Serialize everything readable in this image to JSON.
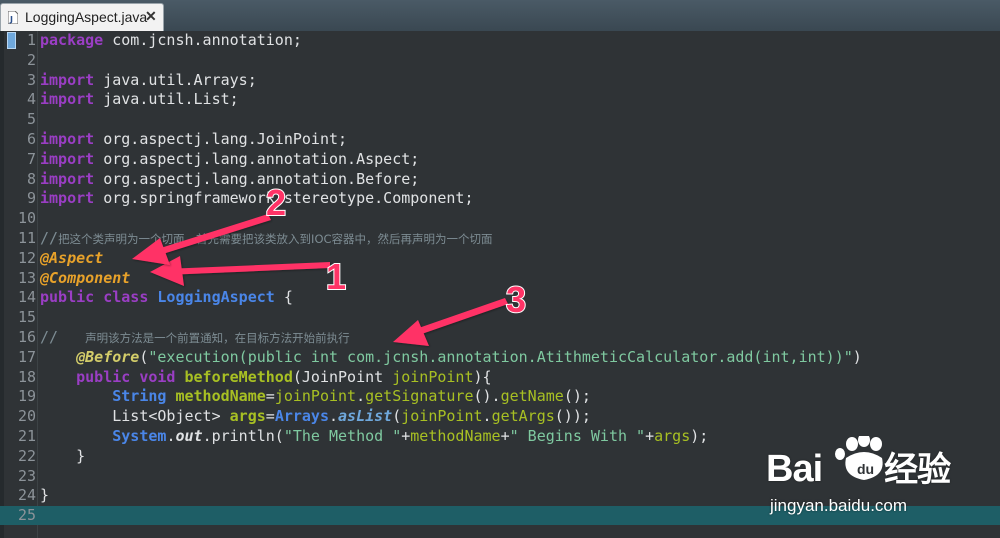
{
  "tab": {
    "title": "LoggingAspect.java",
    "close_glyph": "✕",
    "icon": "java-file-icon"
  },
  "editor": {
    "current_line": 25,
    "lines": [
      {
        "n": "1",
        "tokens": [
          [
            "kw",
            "package"
          ],
          [
            "pl",
            " com.jcnsh.annotation;"
          ]
        ]
      },
      {
        "n": "2",
        "tokens": []
      },
      {
        "n": "3",
        "tokens": [
          [
            "kw",
            "import"
          ],
          [
            "pl",
            " java.util.Arrays;"
          ]
        ]
      },
      {
        "n": "4",
        "tokens": [
          [
            "kw",
            "import"
          ],
          [
            "pl",
            " java.util.List;"
          ]
        ]
      },
      {
        "n": "5",
        "tokens": []
      },
      {
        "n": "6",
        "tokens": [
          [
            "kw",
            "import"
          ],
          [
            "pl",
            " org.aspectj.lang.JoinPoint;"
          ]
        ]
      },
      {
        "n": "7",
        "tokens": [
          [
            "kw",
            "import"
          ],
          [
            "pl",
            " org.aspectj.lang.annotation.Aspect;"
          ]
        ]
      },
      {
        "n": "8",
        "tokens": [
          [
            "kw",
            "import"
          ],
          [
            "pl",
            " org.aspectj.lang.annotation.Before;"
          ]
        ]
      },
      {
        "n": "9",
        "tokens": [
          [
            "kw",
            "import"
          ],
          [
            "pl",
            " org.springframework.stereotype.Component;"
          ]
        ]
      },
      {
        "n": "10",
        "tokens": []
      },
      {
        "n": "11",
        "tokens": [
          [
            "cmt-mono",
            "//"
          ],
          [
            "cmt",
            "把这个类声明为一个切面，首先需要把该类放入到IOC容器中，然后再声明为一个切面"
          ]
        ]
      },
      {
        "n": "12",
        "tokens": [
          [
            "ann",
            "@Aspect"
          ]
        ]
      },
      {
        "n": "13",
        "tokens": [
          [
            "ann",
            "@Component"
          ]
        ]
      },
      {
        "n": "14",
        "tokens": [
          [
            "kw",
            "public"
          ],
          [
            "pl",
            " "
          ],
          [
            "kw",
            "class"
          ],
          [
            "pl",
            " "
          ],
          [
            "type",
            "LoggingAspect"
          ],
          [
            "pl",
            " {"
          ]
        ]
      },
      {
        "n": "15",
        "tokens": []
      },
      {
        "n": "16",
        "tokens": [
          [
            "cmt-mono",
            "//   "
          ],
          [
            "cmt",
            "声明该方法是一个前置通知，在目标方法开始前执行"
          ]
        ]
      },
      {
        "n": "17",
        "tokens": [
          [
            "pl",
            "    "
          ],
          [
            "ann-outline",
            "@Before"
          ],
          [
            "pl",
            "("
          ],
          [
            "str",
            "\"execution(public int com.jcnsh.annotation.AtithmeticCalculator.add(int,int))\""
          ],
          [
            "pl",
            ")"
          ]
        ]
      },
      {
        "n": "18",
        "tokens": [
          [
            "pl",
            "    "
          ],
          [
            "kw",
            "public"
          ],
          [
            "pl",
            " "
          ],
          [
            "kw",
            "void"
          ],
          [
            "pl",
            " "
          ],
          [
            "name",
            "beforeMethod"
          ],
          [
            "pl",
            "(JoinPoint "
          ],
          [
            "var",
            "joinPoint"
          ],
          [
            "pl",
            "){"
          ]
        ]
      },
      {
        "n": "19",
        "tokens": [
          [
            "pl",
            "        "
          ],
          [
            "type",
            "String"
          ],
          [
            "pl",
            " "
          ],
          [
            "name",
            "methodName"
          ],
          [
            "pl",
            "="
          ],
          [
            "var",
            "joinPoint"
          ],
          [
            "pl",
            "."
          ],
          [
            "var",
            "getSignature"
          ],
          [
            "pl",
            "()."
          ],
          [
            "var",
            "getName"
          ],
          [
            "pl",
            "();"
          ]
        ]
      },
      {
        "n": "20",
        "tokens": [
          [
            "pl",
            "        List<Object> "
          ],
          [
            "name",
            "args"
          ],
          [
            "pl",
            "="
          ],
          [
            "type",
            "Arrays"
          ],
          [
            "pl",
            "."
          ],
          [
            "static",
            "asList"
          ],
          [
            "pl",
            "("
          ],
          [
            "var",
            "joinPoint"
          ],
          [
            "pl",
            "."
          ],
          [
            "var",
            "getArgs"
          ],
          [
            "pl",
            "());"
          ]
        ]
      },
      {
        "n": "21",
        "tokens": [
          [
            "pl",
            "        "
          ],
          [
            "type",
            "System"
          ],
          [
            "pl",
            "."
          ],
          [
            "field",
            "out"
          ],
          [
            "pl",
            ".println("
          ],
          [
            "str",
            "\"The Method \""
          ],
          [
            "pl",
            "+"
          ],
          [
            "var",
            "methodName"
          ],
          [
            "pl",
            "+"
          ],
          [
            "str",
            "\" Begins With \""
          ],
          [
            "pl",
            "+"
          ],
          [
            "var",
            "args"
          ],
          [
            "pl",
            ");"
          ]
        ]
      },
      {
        "n": "22",
        "tokens": [
          [
            "pl",
            "    }"
          ]
        ]
      },
      {
        "n": "23",
        "tokens": []
      },
      {
        "n": "24",
        "tokens": [
          [
            "pl",
            "}"
          ]
        ]
      },
      {
        "n": "25",
        "tokens": []
      }
    ]
  },
  "annotations": [
    {
      "label": "1",
      "color": "#ff3366"
    },
    {
      "label": "2",
      "color": "#ff3366"
    },
    {
      "label": "3",
      "color": "#ff3366"
    }
  ],
  "watermark": {
    "logo_text": "Bai",
    "logo_text_2": "经验",
    "url": "jingyan.baidu.com"
  }
}
